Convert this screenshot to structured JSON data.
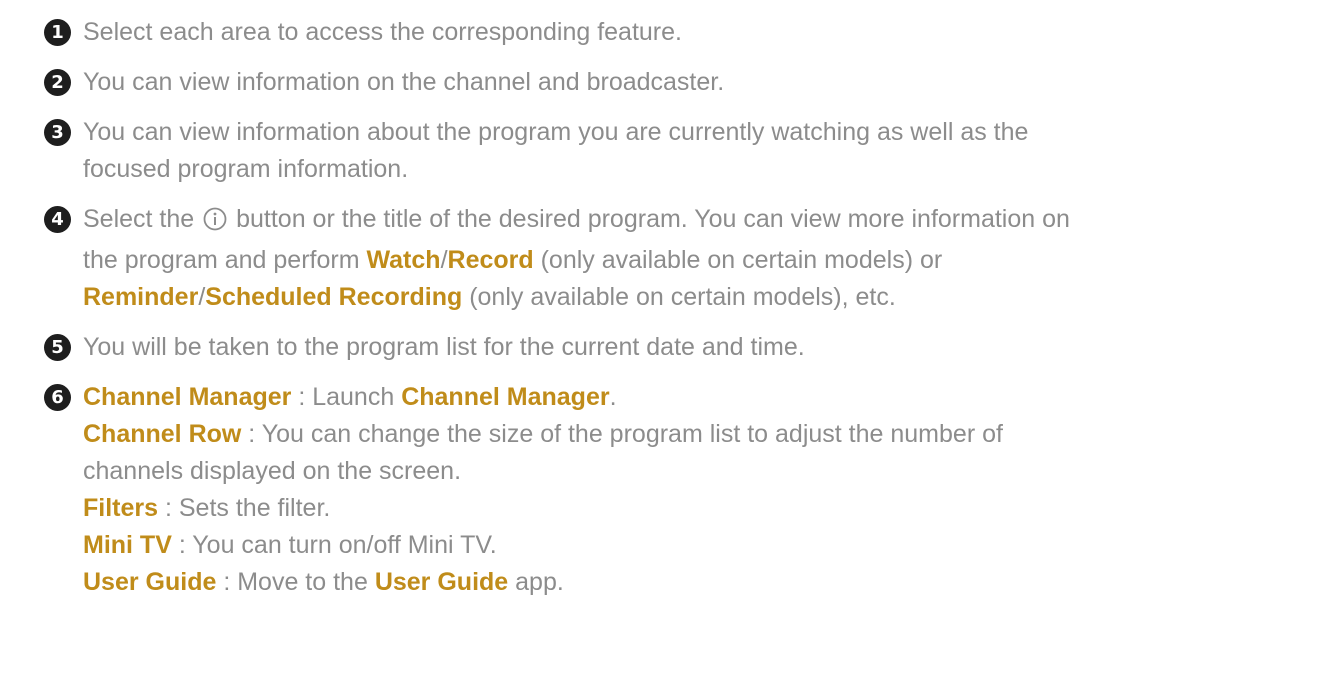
{
  "colors": {
    "text": "#8c8c8c",
    "highlight": "#c08c1a",
    "number_badge": "#1e1e1e"
  },
  "items": [
    {
      "num": "1",
      "text": "Select each area to access the corresponding feature."
    },
    {
      "num": "2",
      "text": "You can view information on the channel and broadcaster."
    },
    {
      "num": "3",
      "line1": "You can view information about the program you are currently watching as well as the",
      "line2": "focused program information."
    },
    {
      "num": "4",
      "t1": "Select the",
      "icon": "info-circle-icon",
      "t2": "button or the title of the desired program. You can view more information on",
      "t3": "the program and perform",
      "watch": "Watch",
      "sep1": "/",
      "record": "Record",
      "t4": "(only available on certain models) or",
      "reminder": "Reminder",
      "sep2": "/",
      "scheduled": "Scheduled Recording",
      "t5": "(only available on certain models), etc."
    },
    {
      "num": "5",
      "text": "You will be taken to the program list for the current date and time."
    },
    {
      "num": "6",
      "rows": [
        {
          "term": "Channel Manager",
          "sep": " : ",
          "desc": "Launch",
          "term2": "Channel Manager",
          "end": "."
        },
        {
          "term": "Channel Row",
          "sep": " : ",
          "desc": "You can change the size of the program list to adjust the number of",
          "desc2": "channels displayed on the screen."
        },
        {
          "term": "Filters",
          "sep": " : ",
          "desc": "Sets the filter."
        },
        {
          "term": "Mini TV",
          "sep": " : ",
          "desc": "You can turn on/off Mini TV."
        },
        {
          "term": "User Guide",
          "sep": " : ",
          "desc": "Move to the",
          "term2": "User Guide",
          "end": "app."
        }
      ]
    }
  ]
}
